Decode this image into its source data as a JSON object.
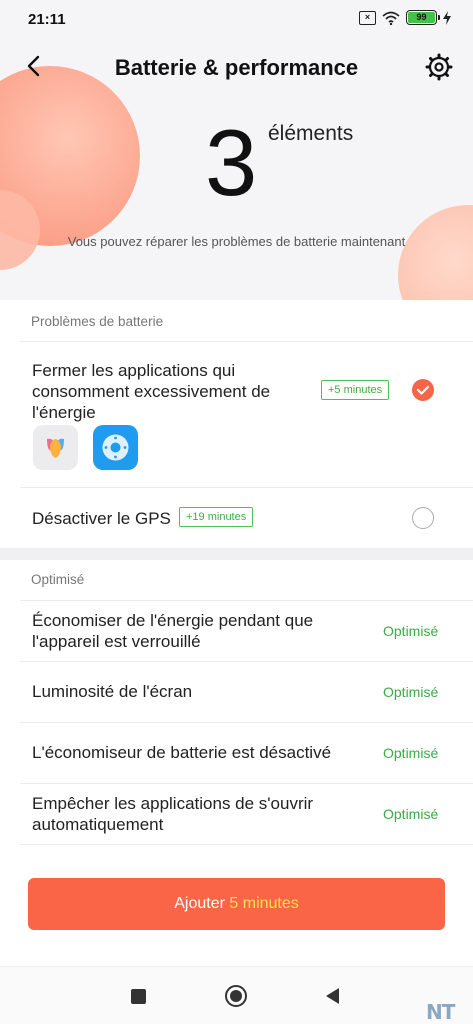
{
  "status_bar": {
    "time": "21:11",
    "battery_level": "99",
    "icons": [
      "sim-x-icon",
      "wifi-icon",
      "battery-icon",
      "charging-bolt-icon"
    ]
  },
  "header": {
    "title": "Batterie & performance",
    "back_icon": "back-chevron-icon",
    "settings_icon": "gear-icon"
  },
  "summary": {
    "count": "3",
    "unit": "éléments",
    "subtitle": "Vous pouvez réparer les problèmes de batterie maintenant"
  },
  "issues_section": {
    "title": "Problèmes de batterie",
    "items": [
      {
        "label": "Fermer les applications qui consomment excessivement de l'énergie",
        "badge": "+5 minutes",
        "checked": true,
        "app_icons": [
          "tulip-app-icon",
          "remote-app-icon"
        ]
      },
      {
        "label": "Désactiver le GPS",
        "badge": "+19 minutes",
        "checked": false
      }
    ]
  },
  "optimized_section": {
    "title": "Optimisé",
    "items": [
      {
        "label": "Économiser de l'énergie pendant que l'appareil est verrouillé",
        "status": "Optimisé"
      },
      {
        "label": "Luminosité de l'écran",
        "status": "Optimisé"
      },
      {
        "label": "L'économiseur de batterie est désactivé",
        "status": "Optimisé"
      },
      {
        "label": "Empêcher les applications de s'ouvrir automatiquement",
        "status": "Optimisé"
      }
    ]
  },
  "action_button": {
    "label": "Ajouter",
    "highlight": "5 minutes"
  },
  "nav_bar": {
    "icons": [
      "recents-square-icon",
      "home-circle-icon",
      "back-triangle-icon"
    ]
  },
  "watermark": "NT",
  "colors": {
    "accent": "#fa6548",
    "optimized_green": "#3aab45",
    "badge_green": "#4fbf59"
  }
}
